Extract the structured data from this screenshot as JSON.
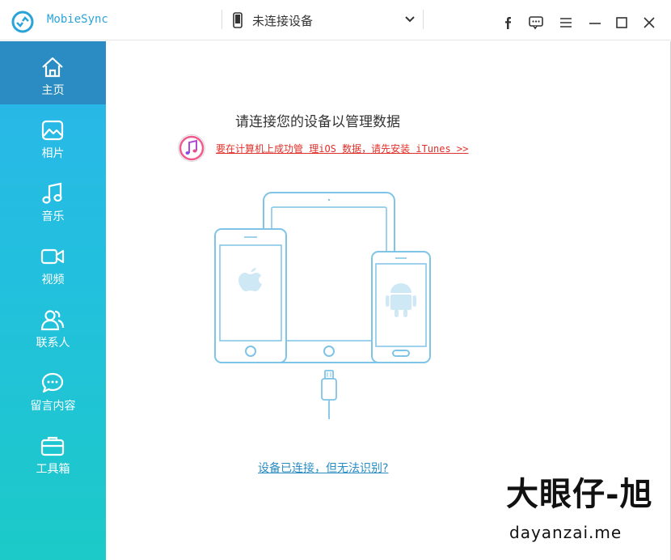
{
  "app": {
    "name": "MobieSync"
  },
  "device_select": {
    "label": "未连接设备"
  },
  "window_controls": [
    "facebook-icon",
    "feedback-icon",
    "menu-icon",
    "minimize-icon",
    "maximize-icon",
    "close-icon"
  ],
  "sidebar": {
    "items": [
      {
        "label": "主页",
        "icon": "home-icon",
        "active": true
      },
      {
        "label": "相片",
        "icon": "photo-icon"
      },
      {
        "label": "音乐",
        "icon": "music-icon"
      },
      {
        "label": "视频",
        "icon": "video-icon"
      },
      {
        "label": "联系人",
        "icon": "contacts-icon"
      },
      {
        "label": "留言内容",
        "icon": "messages-icon"
      },
      {
        "label": "工具箱",
        "icon": "toolbox-icon"
      }
    ]
  },
  "main": {
    "heading": "请连接您的设备以管理数据",
    "itunes_link": "要在计算机上成功管 理iOS 数据，请先安装 iTunes >>",
    "help_link": "设备已连接，但无法识别?"
  },
  "watermark": {
    "cn": "大眼仔-旭",
    "en": "dayanzai.me"
  },
  "colors": {
    "accent": "#2aa3d8",
    "sidebar_active": "#2a8cc2",
    "link_red": "#e0302a",
    "illustration_stroke": "#7fc4e6"
  }
}
